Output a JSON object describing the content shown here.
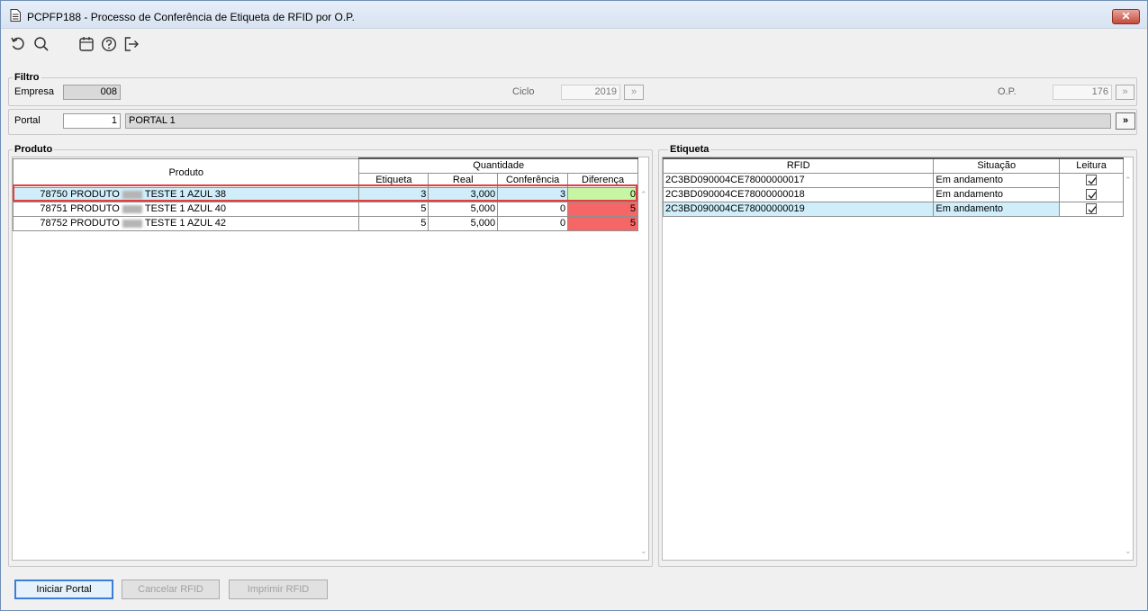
{
  "window": {
    "title": "PCPFP188 - Processo de Conferência de Etiqueta de RFID por O.P.",
    "close_label": "✕"
  },
  "toolbar": {
    "icons": [
      "refresh-icon",
      "search-icon",
      "calendar-icon",
      "help-icon",
      "exit-icon"
    ]
  },
  "filtro": {
    "group_label": "Filtro",
    "empresa_label": "Empresa",
    "empresa_value": "008",
    "ciclo_label": "Ciclo",
    "ciclo_value": "2019",
    "op_label": "O.P.",
    "op_value": "176",
    "lookup_label": "»"
  },
  "portal": {
    "label": "Portal",
    "code": "1",
    "name": "PORTAL 1",
    "button_label": "»"
  },
  "produto": {
    "group_label": "Produto",
    "header_produto": "Produto",
    "header_quantidade": "Quantidade",
    "columns": [
      "Etiqueta",
      "Real",
      "Conferência",
      "Diferença"
    ],
    "rows": [
      {
        "code": "78750",
        "name_a": "PRODUTO",
        "name_b": "TESTE 1 AZUL 38",
        "etiqueta": "3",
        "real": "3,000",
        "conferencia": "3",
        "diferenca": "0",
        "status": "ok"
      },
      {
        "code": "78751",
        "name_a": "PRODUTO",
        "name_b": "TESTE 1 AZUL 40",
        "etiqueta": "5",
        "real": "5,000",
        "conferencia": "0",
        "diferenca": "5",
        "status": "bad"
      },
      {
        "code": "78752",
        "name_a": "PRODUTO",
        "name_b": "TESTE 1 AZUL 42",
        "etiqueta": "5",
        "real": "5,000",
        "conferencia": "0",
        "diferenca": "5",
        "status": "bad"
      }
    ]
  },
  "etiqueta": {
    "group_label": "Etiqueta",
    "columns": [
      "RFID",
      "Situação",
      "Leitura"
    ],
    "rows": [
      {
        "rfid": "2C3BD090004CE78000000017",
        "situacao": "Em andamento",
        "leitura": true
      },
      {
        "rfid": "2C3BD090004CE78000000018",
        "situacao": "Em andamento",
        "leitura": true
      },
      {
        "rfid": "2C3BD090004CE78000000019",
        "situacao": "Em andamento",
        "leitura": true
      }
    ]
  },
  "buttons": {
    "iniciar": "Iniciar Portal",
    "cancelar": "Cancelar RFID",
    "imprimir": "Imprimir RFID"
  },
  "colors": {
    "selected_row": "#cfeefa",
    "diff_ok": "#c6f5a4",
    "diff_bad": "#f56666",
    "highlight_outline": "#e0403f"
  }
}
